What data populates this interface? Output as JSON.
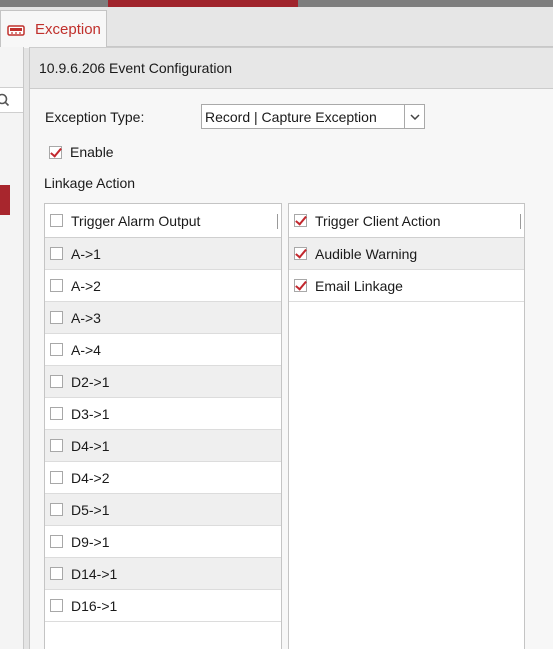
{
  "tab": {
    "label": "Exception",
    "icon": "alarm-host-icon"
  },
  "header": {
    "title": "10.9.6.206 Event Configuration"
  },
  "exception_type": {
    "label": "Exception Type:",
    "value": "Record | Capture Exception"
  },
  "enable": {
    "label": "Enable",
    "checked": true
  },
  "linkage": {
    "label": "Linkage Action"
  },
  "alarm_output": {
    "header": "Trigger Alarm Output",
    "items": [
      {
        "label": "A->1",
        "checked": false
      },
      {
        "label": "A->2",
        "checked": false
      },
      {
        "label": "A->3",
        "checked": false
      },
      {
        "label": "A->4",
        "checked": false
      },
      {
        "label": "D2->1",
        "checked": false
      },
      {
        "label": "D3->1",
        "checked": false
      },
      {
        "label": "D4->1",
        "checked": false
      },
      {
        "label": "D4->2",
        "checked": false
      },
      {
        "label": "D5->1",
        "checked": false
      },
      {
        "label": "D9->1",
        "checked": false
      },
      {
        "label": "D14->1",
        "checked": false
      },
      {
        "label": "D16->1",
        "checked": false
      }
    ]
  },
  "client_action": {
    "header": "Trigger Client Action",
    "header_checked": true,
    "items": [
      {
        "label": "Audible Warning",
        "checked": true
      },
      {
        "label": "Email Linkage",
        "checked": true
      }
    ]
  },
  "colors": {
    "accent": "#c2272d",
    "brand_bar": "#a0242c"
  }
}
